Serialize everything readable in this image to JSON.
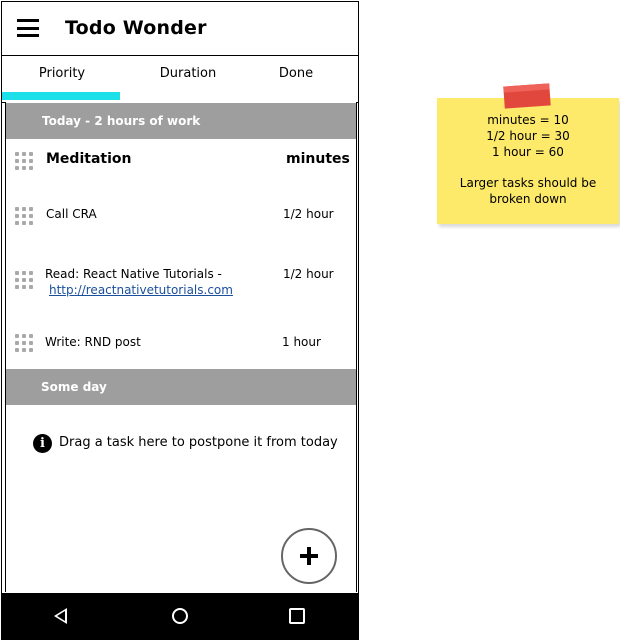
{
  "app": {
    "title": "Todo Wonder"
  },
  "tabs": [
    {
      "label": "Priority",
      "selected": true
    },
    {
      "label": "Duration",
      "selected": false
    },
    {
      "label": "Done",
      "selected": false
    }
  ],
  "sections": {
    "today": {
      "header": "Today - 2 hours of work",
      "tasks": [
        {
          "name": "Meditation",
          "duration": "minutes",
          "bold": true
        },
        {
          "name": "Call CRA",
          "duration": "1/2 hour"
        },
        {
          "name": "Read: React Native Tutorials -",
          "link": "http://reactnativetutorials.com",
          "duration": "1/2 hour"
        },
        {
          "name": "Write: RND post",
          "duration": "1 hour"
        }
      ]
    },
    "someday": {
      "header": "Some day",
      "hint": "Drag a task here to postpone it from today"
    }
  },
  "fab": {
    "label": "+"
  },
  "sticky_note": {
    "lines": [
      "minutes = 10",
      "1/2 hour = 30",
      "1 hour = 60"
    ],
    "note": [
      "Larger tasks should be",
      "broken down"
    ]
  },
  "colors": {
    "tab_indicator": "#1be0ea",
    "section_header": "#9e9e9e",
    "link": "#1a4f9c",
    "sticky": "#fde96a",
    "tape": "#e2473d"
  }
}
